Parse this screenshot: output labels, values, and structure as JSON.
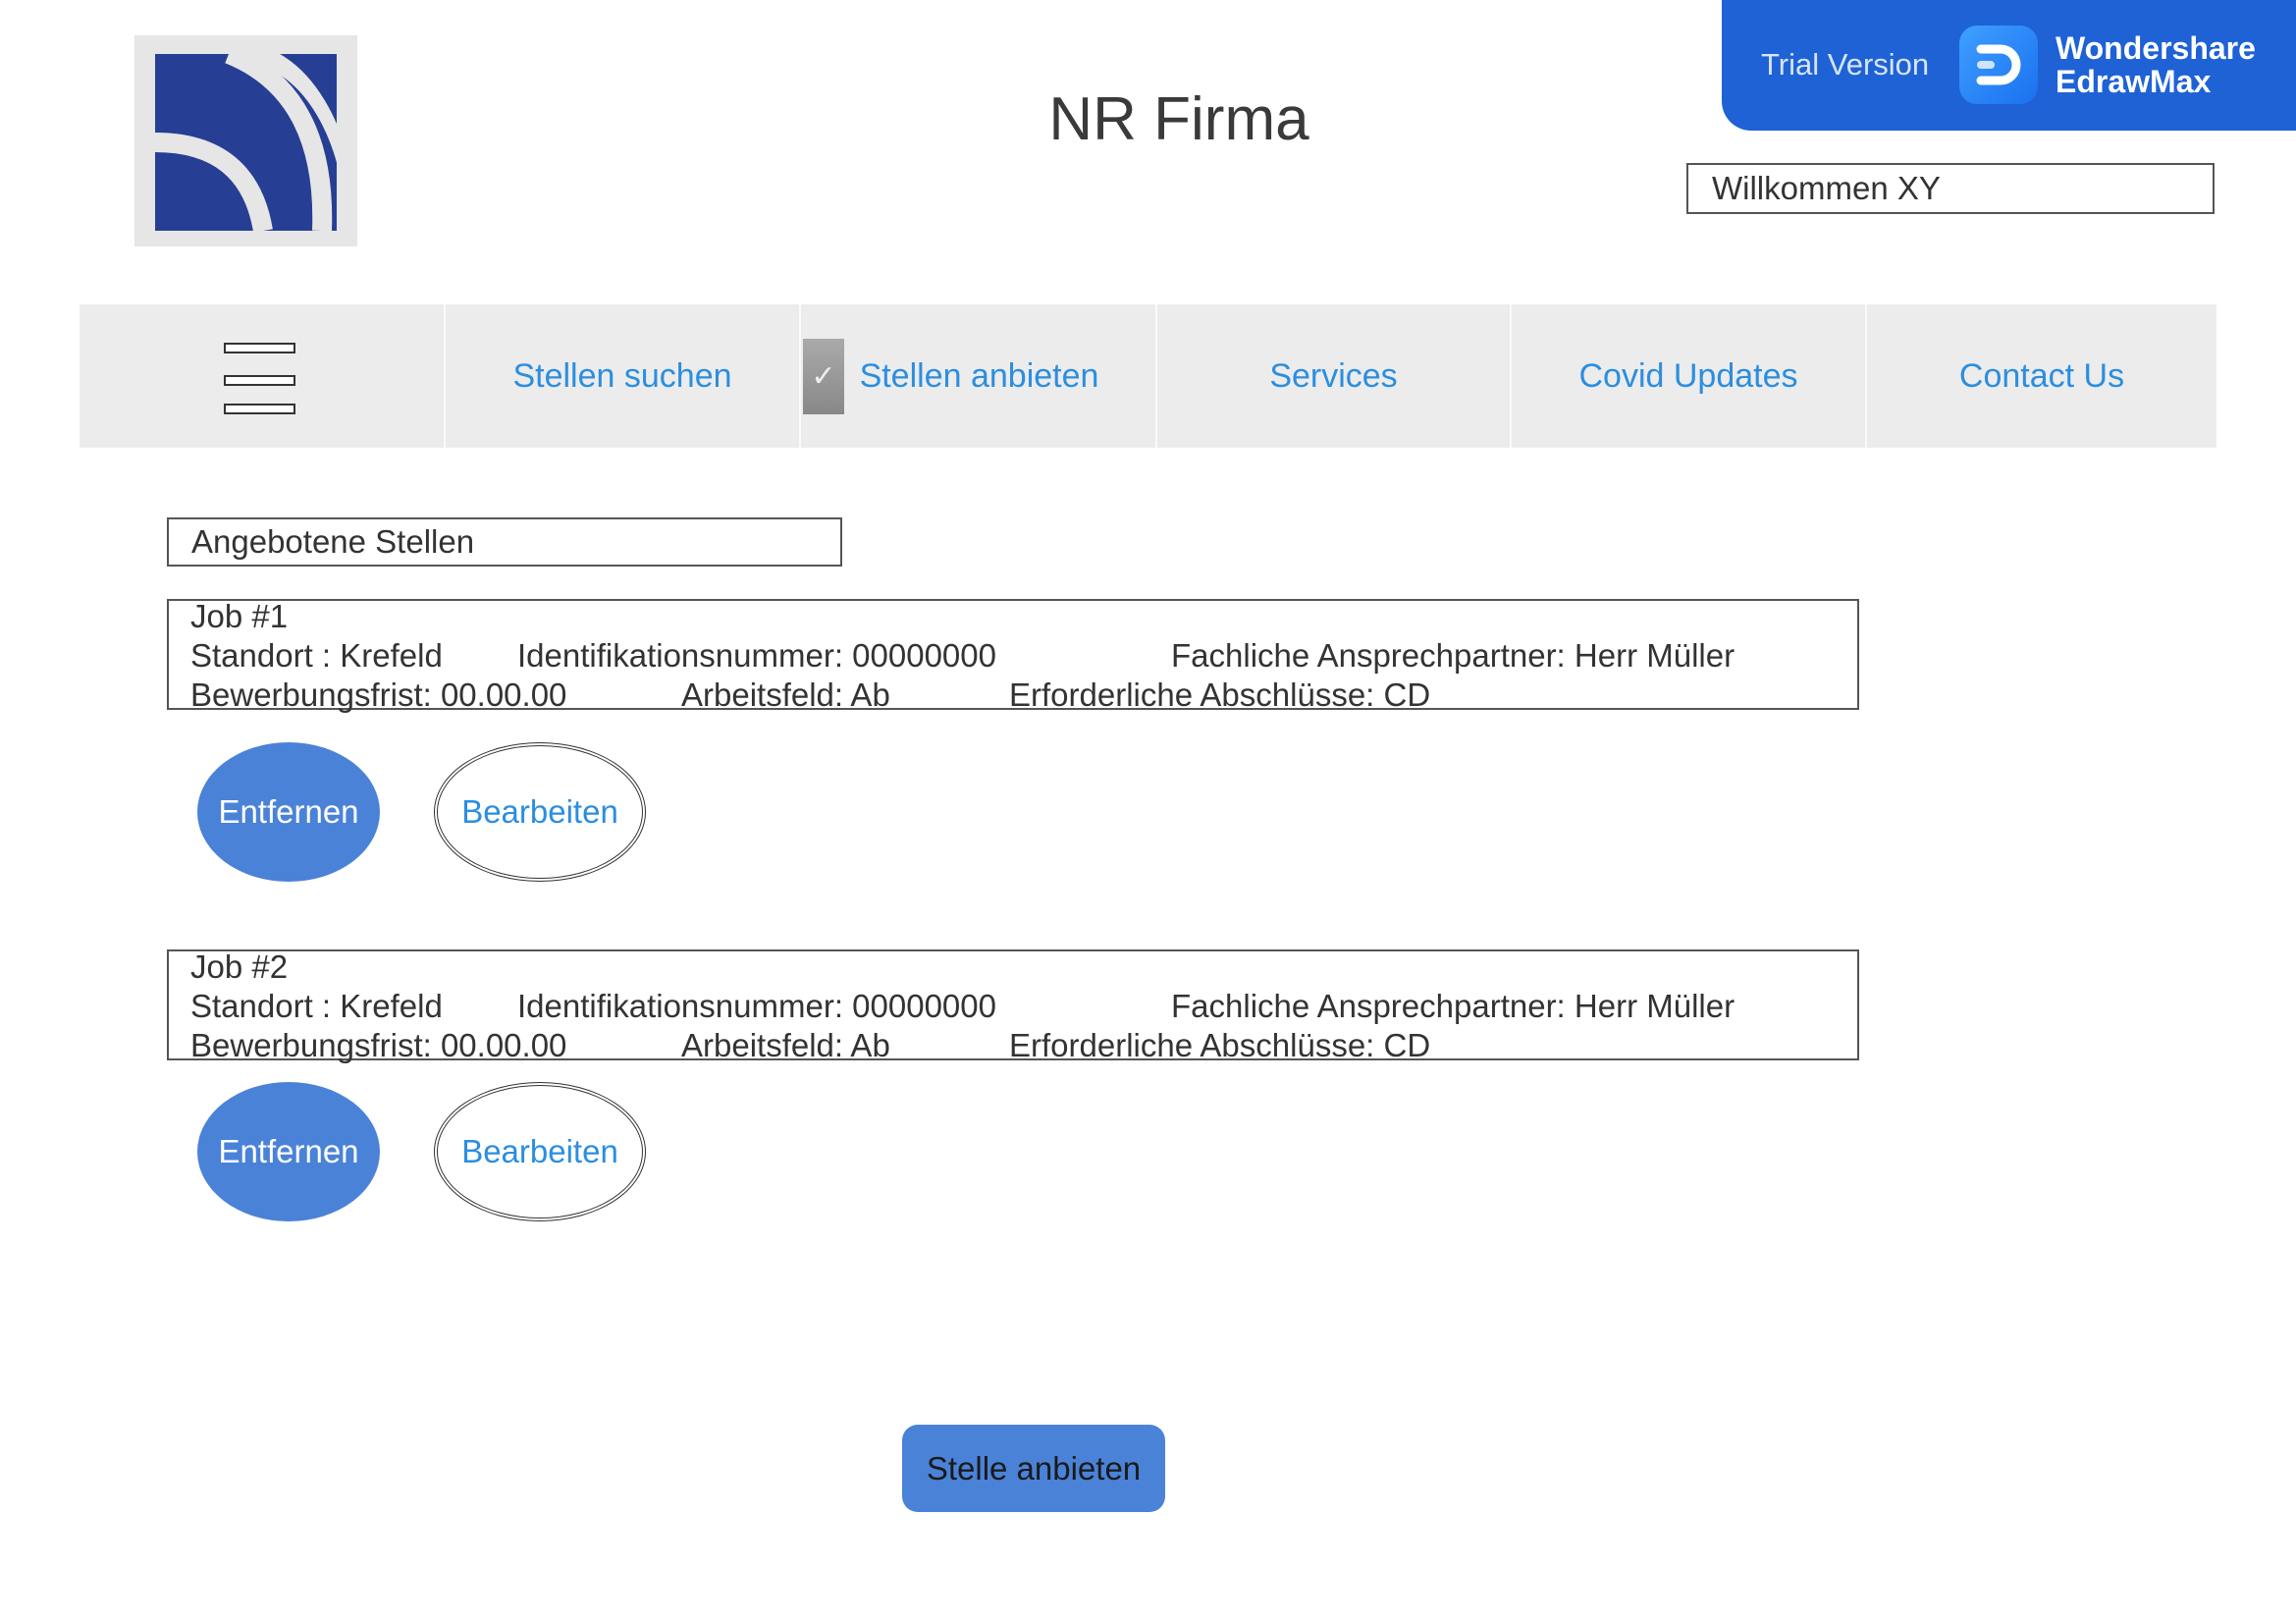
{
  "header": {
    "title": "NR Firma",
    "welcome": "Willkommen XY",
    "trial": {
      "label": "Trial Version",
      "brand_line1": "Wondershare",
      "brand_line2": "EdrawMax"
    }
  },
  "nav": {
    "menu_icon": "hamburger-icon",
    "items": [
      {
        "label": "Stellen suchen"
      },
      {
        "label": "Stellen anbieten",
        "active": true
      },
      {
        "label": "Services"
      },
      {
        "label": "Covid Updates"
      },
      {
        "label": "Contact Us"
      }
    ],
    "check_mark": "✓"
  },
  "section_title": "Angebotene Stellen",
  "jobs": [
    {
      "title": "Job #1",
      "standort": "Standort : Krefeld",
      "id": "Identifikationsnummer: 00000000",
      "contact": "Fachliche Ansprechpartner: Herr Müller",
      "deadline": "Bewerbungsfrist: 00.00.00",
      "field": "Arbeitsfeld: Ab",
      "degrees": "Erforderliche Abschlüsse: CD",
      "remove_label": "Entfernen",
      "edit_label": "Bearbeiten"
    },
    {
      "title": "Job #2",
      "standort": "Standort : Krefeld",
      "id": "Identifikationsnummer: 00000000",
      "contact": "Fachliche Ansprechpartner: Herr Müller",
      "deadline": "Bewerbungsfrist: 00.00.00",
      "field": "Arbeitsfeld: Ab",
      "degrees": "Erforderliche Abschlüsse: CD",
      "remove_label": "Entfernen",
      "edit_label": "Bearbeiten"
    }
  ],
  "offer_button": "Stelle anbieten",
  "colors": {
    "brand_blue": "#1e62d6",
    "button_blue": "#4a82d8",
    "link_blue": "#2b8ee0",
    "logo_navy": "#263f94"
  }
}
